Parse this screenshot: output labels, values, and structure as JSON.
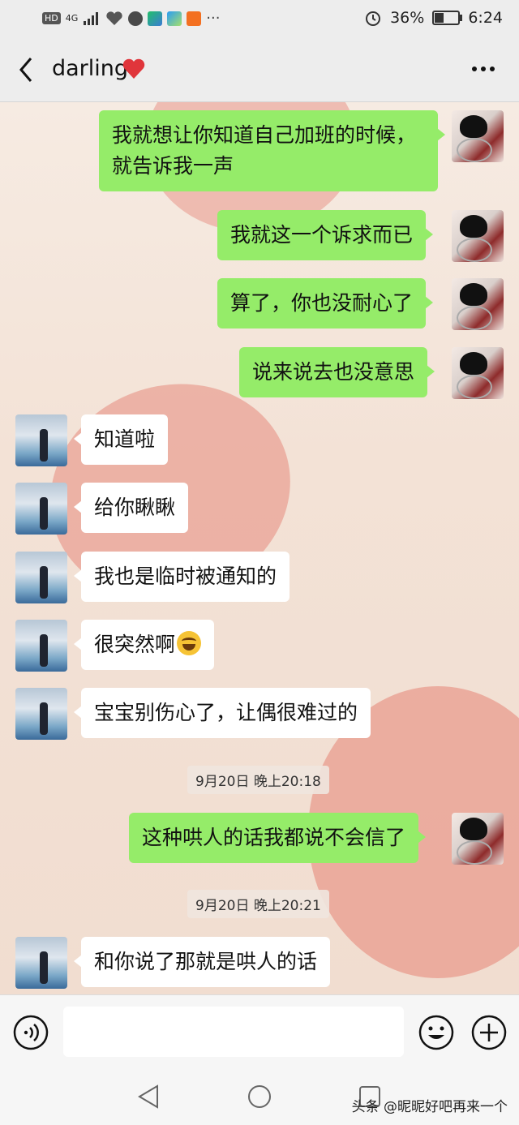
{
  "status_bar": {
    "network_label": "HD",
    "signal_label": "4G",
    "battery_text": "36%",
    "battery_level": 0.36,
    "time": "6:24"
  },
  "header": {
    "title": "darling",
    "title_icon": "red-heart-icon"
  },
  "timestamps": [
    "9月20日 晚上20:18",
    "9月20日 晚上20:21"
  ],
  "messages": [
    {
      "side": "right",
      "text": "我就想让你知道自己加班的时候，就告诉我一声"
    },
    {
      "side": "right",
      "text": "我就这一个诉求而已"
    },
    {
      "side": "right",
      "text": "算了，你也没耐心了"
    },
    {
      "side": "right",
      "text": "说来说去也没意思"
    },
    {
      "side": "left",
      "text": "知道啦"
    },
    {
      "side": "left",
      "text": "给你瞅瞅"
    },
    {
      "side": "left",
      "text": "我也是临时被通知的"
    },
    {
      "side": "left",
      "text": "很突然啊",
      "emoji": "tears-of-joy-icon"
    },
    {
      "side": "left",
      "text": "宝宝别伤心了，让偶很难过的"
    },
    {
      "side": "right",
      "text": "这种哄人的话我都说不会信了"
    },
    {
      "side": "left",
      "text": "和你说了那就是哄人的话"
    }
  ],
  "input": {
    "value": "",
    "placeholder": ""
  },
  "watermark": "头条 @昵昵好吧再来一个",
  "colors": {
    "bubble_self": "#95ec69",
    "bubble_other": "#ffffff",
    "header_bg": "#ededed"
  }
}
